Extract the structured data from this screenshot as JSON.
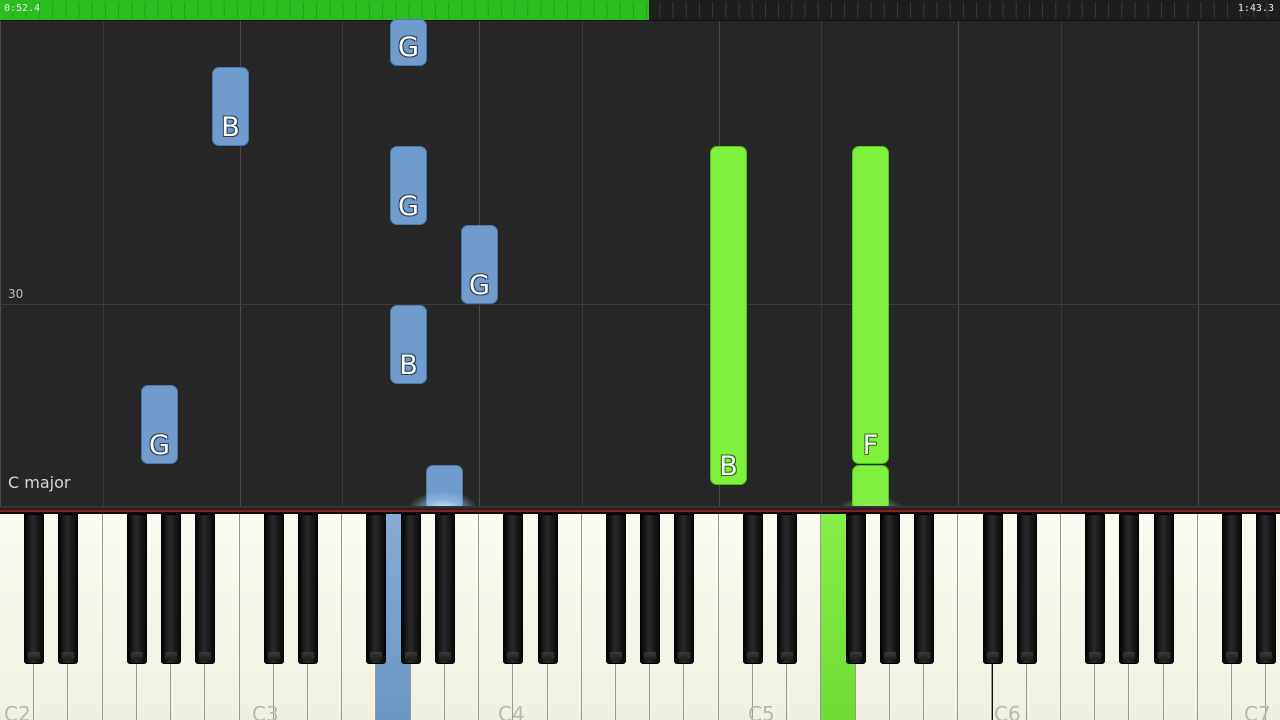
{
  "playback": {
    "current_time": "0:52.4",
    "total_time": "1:43.3",
    "progress_fraction": 0.507,
    "progress_color": "#2cbe21"
  },
  "roll": {
    "measure_number": "30",
    "key_signature": "C major"
  },
  "notes": [
    {
      "label": "G",
      "hand": "left",
      "color": "#6f9ccc"
    },
    {
      "label": "B",
      "hand": "left",
      "color": "#6f9ccc"
    },
    {
      "label": "G",
      "hand": "left",
      "color": "#6f9ccc"
    },
    {
      "label": "G",
      "hand": "left",
      "color": "#6f9ccc"
    },
    {
      "label": "B",
      "hand": "left",
      "color": "#6f9ccc"
    },
    {
      "label": "G",
      "hand": "left",
      "color": "#6f9ccc"
    },
    {
      "label": "B",
      "hand": "right",
      "color": "#7ff03d"
    },
    {
      "label": "F",
      "hand": "right",
      "color": "#7ff03d"
    },
    {
      "label": "",
      "hand": "left",
      "color": "#6f9ccc"
    },
    {
      "label": "",
      "hand": "right",
      "color": "#7ff03d"
    }
  ],
  "keyboard": {
    "octave_labels": [
      "C2",
      "C3",
      "C4",
      "C5",
      "C6",
      "C7"
    ],
    "pressed_keys": [
      {
        "note": "G3",
        "color": "#6f9ccc"
      },
      {
        "note": "F5",
        "color": "#7ff03d"
      }
    ]
  }
}
